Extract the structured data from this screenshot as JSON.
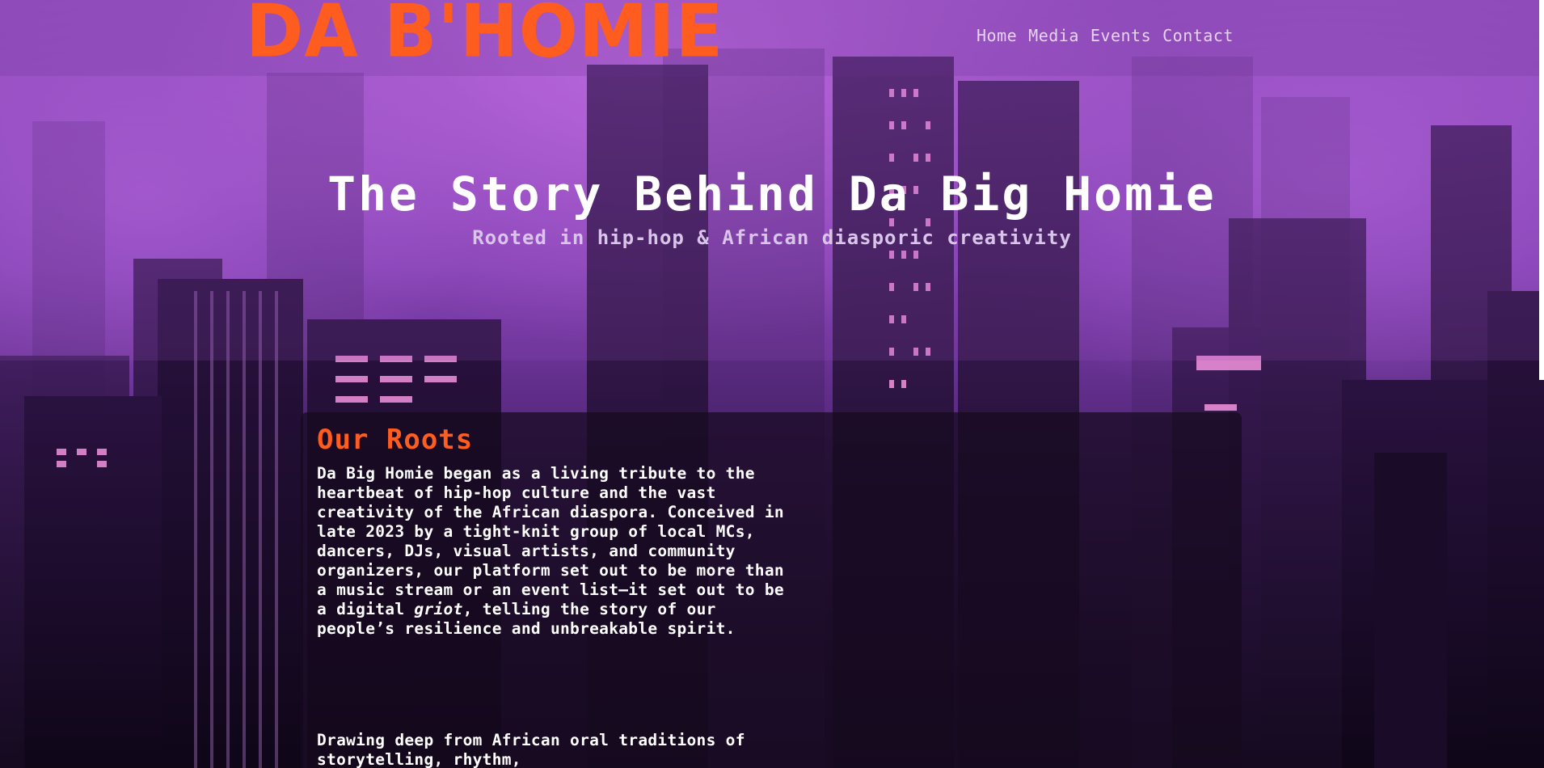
{
  "header": {
    "logo": "DA B'HOMIE",
    "nav": [
      "Home",
      "Media",
      "Events",
      "Contact"
    ]
  },
  "hero": {
    "title": "The Story Behind Da Big Homie",
    "subtitle": "Rooted in hip-hop & African diasporic creativity"
  },
  "section": {
    "heading": "Our Roots",
    "para1_before": "Da Big Homie began as a living tribute to the heartbeat of hip-hop culture and the vast creativity of the African diaspora. Conceived in late 2023 by a tight-knit group of local MCs, dancers, DJs, visual artists, and community organizers, our platform set out to be more than a music stream or an event list—it set out to be a digital ",
    "para1_em": "griot",
    "para1_after": ", telling the story of our people’s resilience and unbreakable spirit.",
    "para2": "Drawing deep from African oral traditions of storytelling, rhythm,"
  },
  "colors": {
    "brand": "#ff5c1f",
    "nav_text": "#e7d3f3",
    "background": "#7f3fb0"
  }
}
